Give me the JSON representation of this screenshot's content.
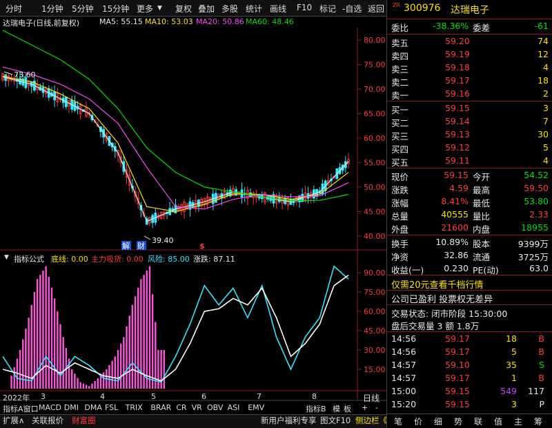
{
  "toolbar": {
    "items": [
      "分时",
      "1分钟",
      "5分钟",
      "15分钟",
      "更多"
    ],
    "right_items": [
      "复权",
      "叠加",
      "多股",
      "统计",
      "画线",
      "F10",
      "标记",
      "-自选",
      "返回"
    ]
  },
  "header": {
    "title": "达瑞电子(日线,前复权)",
    "ma5": "MA5: 55.15",
    "ma10": "MA10: 53.03",
    "ma20": "MA20: 50.86",
    "ma60": "MA60: 48.46"
  },
  "price_chart": {
    "ticks": [
      "80.00",
      "75.00",
      "70.00",
      "65.00",
      "60.00",
      "55.00",
      "50.00",
      "45.00",
      "40.00"
    ],
    "high_label": "73.60",
    "low_label": "39.40",
    "markers": [
      "解",
      "财",
      "$"
    ]
  },
  "indicator": {
    "name": "指标公式",
    "bottom_line": "底线: 0.00",
    "main_buy": "主力吸货: 0.00",
    "risk": "风险: 85.00",
    "updown": "涨跌: 87.11",
    "ticks": [
      "90.00",
      "75.00",
      "60.00",
      "45.00",
      "30.00",
      "15.00"
    ]
  },
  "date_axis": {
    "year": "2022年",
    "months": [
      "3",
      "4",
      "5",
      "6",
      "7",
      "8"
    ]
  },
  "bottom_tabs": [
    "指标A",
    "窗口",
    "MACD",
    "DMI",
    "DMA",
    "FSL",
    "TRIX",
    "BRAR",
    "CR",
    "VR",
    "OBV",
    "ASI",
    "EMV"
  ],
  "bottom_tabs_right": [
    "指标B",
    "模",
    "板"
  ],
  "status_bar": {
    "left": [
      "扩展∧",
      "关联报价",
      "财富圈"
    ],
    "right": [
      "新用户福利专享",
      "图文F10",
      "侧边栏《"
    ]
  },
  "quote": {
    "zr": "ZR",
    "code": "300976",
    "name": "达瑞电子",
    "weibi_label": "委比",
    "weibi": "-38.36%",
    "weicha_label": "委差",
    "weicha": "-61",
    "sells": [
      {
        "label": "卖五",
        "price": "59.20",
        "vol": "74"
      },
      {
        "label": "卖四",
        "price": "59.19",
        "vol": "12"
      },
      {
        "label": "卖三",
        "price": "59.18",
        "vol": "4"
      },
      {
        "label": "卖二",
        "price": "59.17",
        "vol": "18"
      },
      {
        "label": "卖一",
        "price": "59.16",
        "vol": "2"
      }
    ],
    "buys": [
      {
        "label": "买一",
        "price": "59.15",
        "vol": "3"
      },
      {
        "label": "买二",
        "price": "59.14",
        "vol": "7"
      },
      {
        "label": "买三",
        "price": "59.13",
        "vol": "30"
      },
      {
        "label": "买四",
        "price": "59.12",
        "vol": "5"
      },
      {
        "label": "买五",
        "price": "59.11",
        "vol": "4"
      }
    ],
    "stats": [
      {
        "l1": "现价",
        "v1": "59.15",
        "l2": "今开",
        "v2": "54.52"
      },
      {
        "l1": "涨跌",
        "v1": "4.59",
        "l2": "最高",
        "v2": "59.50"
      },
      {
        "l1": "涨幅",
        "v1": "8.41%",
        "l2": "最低",
        "v2": "53.80"
      },
      {
        "l1": "总量",
        "v1": "40555",
        "l2": "量比",
        "v2": "2.33"
      },
      {
        "l1": "外盘",
        "v1": "21600",
        "l2": "内盘",
        "v2": "18955"
      }
    ],
    "stats2": [
      {
        "l1": "换手",
        "v1": "10.89%",
        "l2": "股本",
        "v2": "9399万"
      },
      {
        "l1": "净资",
        "v1": "32.86",
        "l2": "流通",
        "v2": "3725万"
      },
      {
        "l1": "收益(一)",
        "v1": "0.230",
        "l2": "PE(动)",
        "v2": "63.0"
      }
    ],
    "promo": "仅需20元查看千档行情",
    "info1": "公司已盈利 投票权无差异",
    "trade_state": "交易状态: 闭市阶段 15:30:00",
    "after_hours": "盘后交易量 3 额 1.8万",
    "ticks_list": [
      {
        "time": "14:56",
        "price": "59.17",
        "vol": "18",
        "flag": "B"
      },
      {
        "time": "14:56",
        "price": "59.17",
        "vol": "5",
        "flag": "B"
      },
      {
        "time": "14:57",
        "price": "59.10",
        "vol": "35",
        "flag": "S"
      },
      {
        "time": "14:57",
        "price": "59.17",
        "vol": "1",
        "flag": "B"
      },
      {
        "time": "15:00",
        "price": "59.15",
        "vol": "549",
        "flag": "117"
      },
      {
        "time": "15:20",
        "price": "59.15",
        "vol": "3",
        "flag": "P"
      }
    ],
    "right_tabs": [
      "笔",
      "价",
      "细",
      "势",
      "联",
      "值",
      "主",
      "筹"
    ],
    "tab_daily": "日线"
  },
  "chart_data": [
    {
      "type": "line",
      "title": "达瑞电子(日线,前复权)",
      "ylim": [
        38,
        82
      ],
      "series": [
        {
          "name": "MA5",
          "x": [
            0,
            10,
            20,
            30,
            40,
            50,
            60,
            70,
            80,
            90,
            100,
            110,
            120
          ],
          "values": [
            72.5,
            71,
            68,
            65,
            57,
            43,
            45.5,
            47,
            49,
            48,
            47,
            49,
            55.2
          ]
        },
        {
          "name": "MA10",
          "x": [
            0,
            10,
            20,
            30,
            40,
            50,
            60,
            70,
            80,
            90,
            100,
            110,
            120
          ],
          "values": [
            72.6,
            71.5,
            69,
            66,
            59,
            46,
            45,
            46.5,
            48.6,
            48.5,
            47.5,
            48.5,
            53
          ]
        },
        {
          "name": "MA20",
          "x": [
            0,
            10,
            20,
            30,
            40,
            50,
            60,
            70,
            80,
            90,
            100,
            110,
            120
          ],
          "values": [
            74.5,
            73,
            71,
            68,
            63,
            54,
            46,
            45.5,
            47.5,
            48.5,
            48,
            48.2,
            50.9
          ]
        },
        {
          "name": "MA60",
          "x": [
            0,
            10,
            20,
            30,
            40,
            50,
            60,
            70,
            80,
            90,
            100,
            110,
            120
          ],
          "values": [
            82,
            79,
            76,
            72,
            66,
            58,
            53,
            50,
            49,
            48,
            47.2,
            47.3,
            48.5
          ]
        }
      ]
    },
    {
      "type": "line",
      "title": "指标公式",
      "ylim": [
        0,
        100
      ],
      "series": [
        {
          "name": "风险",
          "x": [
            0,
            5,
            10,
            15,
            20,
            25,
            30,
            35,
            40,
            45,
            50,
            55,
            60,
            65,
            70,
            75,
            80,
            85,
            90,
            95,
            100,
            105,
            110,
            115,
            120
          ],
          "values": [
            25,
            8,
            6,
            25,
            10,
            25,
            18,
            8,
            6,
            20,
            8,
            5,
            25,
            50,
            80,
            65,
            78,
            55,
            80,
            40,
            15,
            40,
            55,
            95,
            85
          ]
        },
        {
          "name": "涨跌",
          "x": [
            0,
            5,
            10,
            15,
            20,
            25,
            30,
            35,
            40,
            45,
            50,
            55,
            60,
            65,
            70,
            75,
            80,
            85,
            90,
            95,
            100,
            105,
            110,
            115,
            120
          ],
          "values": [
            15,
            12,
            8,
            18,
            12,
            20,
            15,
            10,
            8,
            15,
            10,
            6,
            15,
            35,
            60,
            62,
            70,
            65,
            78,
            55,
            25,
            35,
            50,
            80,
            88
          ]
        },
        {
          "name": "主力吸货",
          "x": [
            3,
            6,
            9,
            12,
            15,
            18,
            21,
            24,
            27,
            30,
            33,
            36,
            39,
            42,
            45,
            48,
            51,
            54
          ],
          "values": [
            10,
            30,
            55,
            85,
            95,
            70,
            40,
            15,
            5,
            2,
            8,
            15,
            25,
            40,
            65,
            85,
            95,
            30
          ]
        }
      ]
    }
  ]
}
